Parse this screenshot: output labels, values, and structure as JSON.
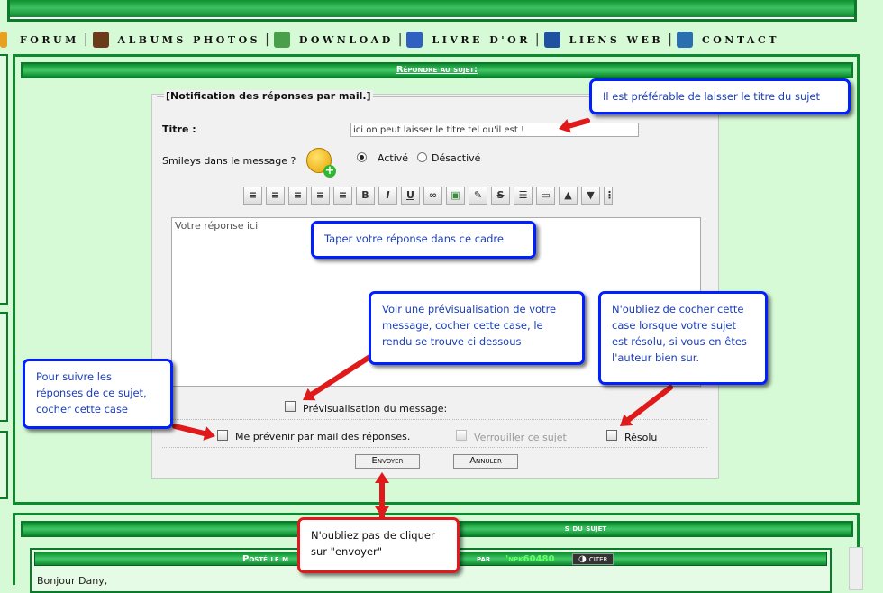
{
  "nav": {
    "items": [
      {
        "label": "Forum",
        "icon": "forum-icon",
        "color": "#e8a020"
      },
      {
        "label": "Albums photos",
        "icon": "album-icon",
        "color": "#6b3b1a"
      },
      {
        "label": "Download",
        "icon": "download-icon",
        "color": "#4aa04a"
      },
      {
        "label": "Livre d'or",
        "icon": "guestbook-icon",
        "color": "#3060c0"
      },
      {
        "label": "Liens Web",
        "icon": "globe-icon",
        "color": "#2050a0"
      },
      {
        "label": "Contact",
        "icon": "contact-icon",
        "color": "#2a70b0"
      }
    ]
  },
  "panel": {
    "title": "Répondre au sujet:"
  },
  "form": {
    "legend": "[Notification des réponses par mail.]",
    "title_label": "Titre :",
    "title_value": "ici on peut laisser le titre tel qu'il est !",
    "smileys_label": "Smileys dans le message ?",
    "smileys_on": "Activé",
    "smileys_off": "Désactivé",
    "toolbar": [
      "align-left",
      "align-center",
      "justify",
      "align-right",
      "strikethrough",
      "B",
      "I",
      "U",
      "link",
      "image",
      "highlight",
      "S",
      "list",
      "page",
      "up",
      "down",
      "more"
    ],
    "textarea_value": "Votre réponse ici",
    "preview_label": "Prévisualisation du message:",
    "notify_label": "Me prévenir par mail des réponses.",
    "lock_label": "Verrouiller ce sujet",
    "resolved_label": "Résolu",
    "send_label": "Envoyer",
    "cancel_label": "Annuler"
  },
  "panel2": {
    "title": "s du sujet",
    "post_header_left": "Posté le m",
    "post_header_right": "par",
    "post_author": "npk60480",
    "quote_label": "citer",
    "body_first_line": "Bonjour Dany,"
  },
  "notes": {
    "title_note": "Il est préférable de laisser le titre du sujet",
    "reply_note": "Taper votre réponse dans ce cadre",
    "preview_note": "Voir une prévisualisation de votre message, cocher cette case, le rendu se trouve ci dessous",
    "resolved_note": "N'oubliez de cocher cette case lorsque votre sujet est résolu, si vous en êtes l'auteur bien sur.",
    "notify_note": "Pour suivre les réponses de ce sujet, cocher cette case",
    "send_note": "N'oubliez pas de cliquer sur \"envoyer\""
  },
  "colors": {
    "accent_green": "#0c8a2e",
    "page_bg": "#d6fad6",
    "note_border_blue": "#0020ff",
    "note_border_red": "#e01a1a",
    "arrow_red": "#e01a1a"
  }
}
